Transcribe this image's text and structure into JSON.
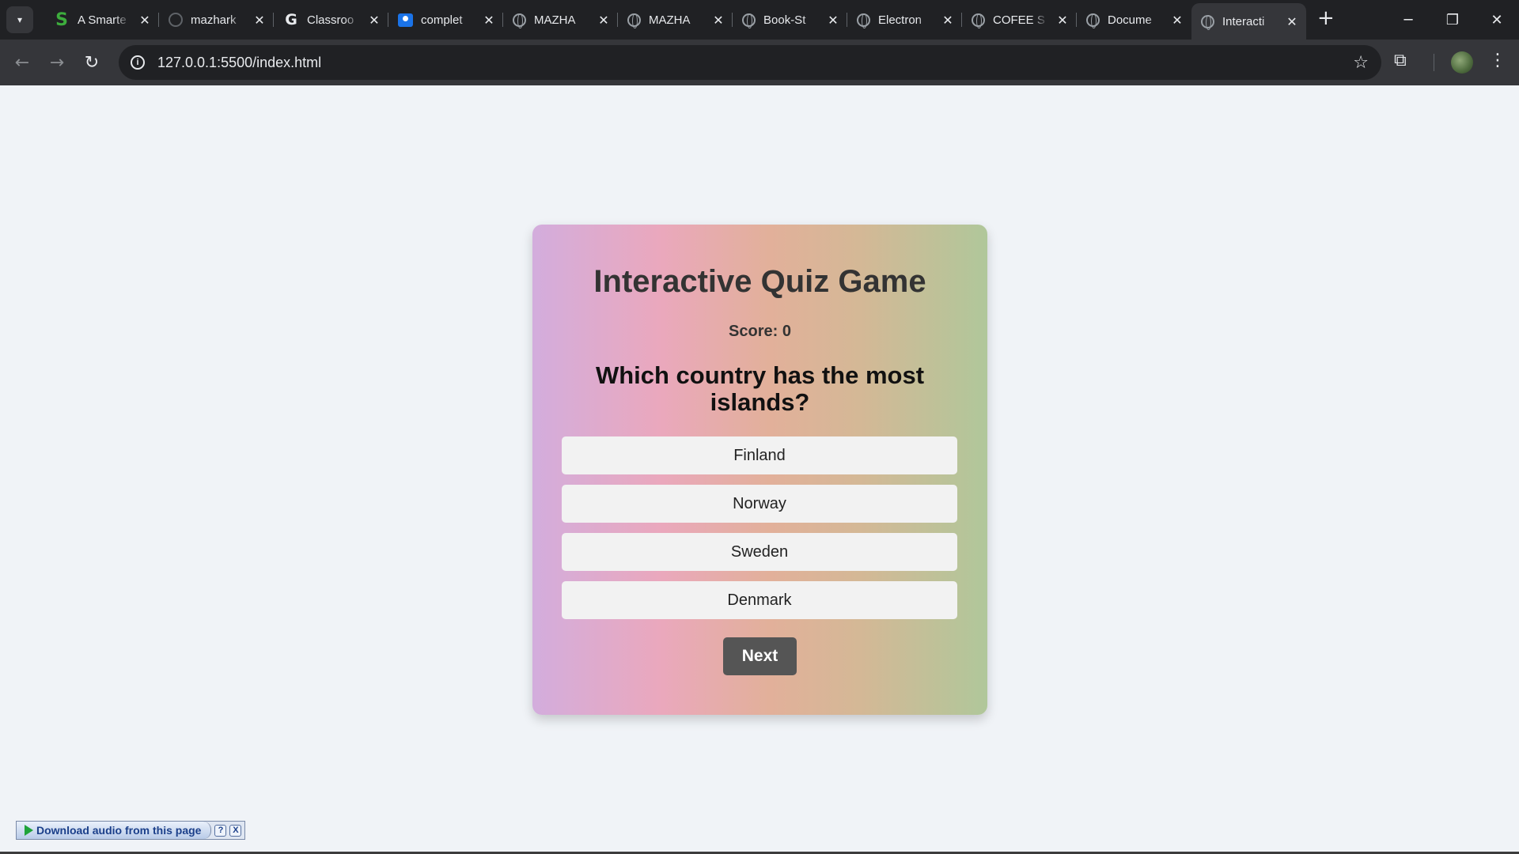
{
  "browser": {
    "tabs": [
      {
        "title": "A Smarte",
        "icon": "s-favicon"
      },
      {
        "title": "mazhark",
        "icon": "github-favicon"
      },
      {
        "title": "Classroo",
        "icon": "google-favicon"
      },
      {
        "title": "complet",
        "icon": "classroom-favicon"
      },
      {
        "title": "MAZHA",
        "icon": "globe-favicon"
      },
      {
        "title": "MAZHA",
        "icon": "globe-favicon"
      },
      {
        "title": "Book-St",
        "icon": "globe-favicon"
      },
      {
        "title": "Electron",
        "icon": "globe-favicon"
      },
      {
        "title": "COFEE S",
        "icon": "globe-favicon"
      },
      {
        "title": "Docume",
        "icon": "globe-favicon"
      },
      {
        "title": "Interacti",
        "icon": "globe-favicon",
        "active": true
      }
    ],
    "url": "127.0.0.1:5500/index.html"
  },
  "quiz": {
    "title": "Interactive Quiz Game",
    "score_text": "Score: 0",
    "question": "Which country has the most islands?",
    "answers": [
      "Finland",
      "Norway",
      "Sweden",
      "Denmark"
    ],
    "next_label": "Next"
  },
  "extension": {
    "audio_label": "Download audio from this page",
    "help_label": "?",
    "close_label": "X"
  },
  "colors": {
    "page_background": "#f0f3f7",
    "next_button": "#555555",
    "answer_button": "#f2f2f2"
  }
}
